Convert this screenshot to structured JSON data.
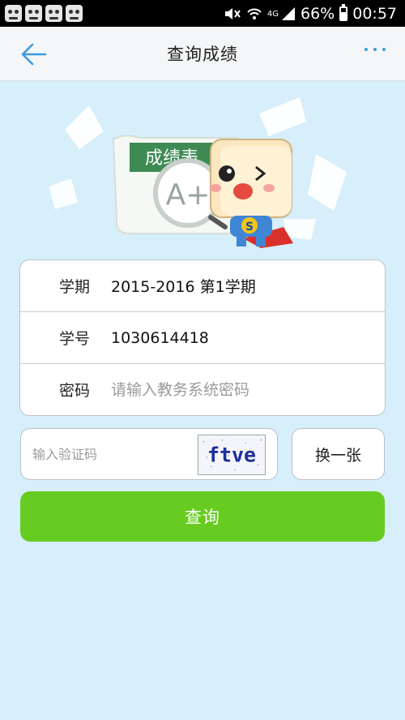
{
  "status_bar": {
    "signal_label": "4G",
    "battery_percent": "66%",
    "time": "00:57",
    "icons": [
      "app-notification-icon",
      "app-notification-icon",
      "app-notification-icon",
      "app-notification-icon",
      "mute-icon",
      "wifi-icon",
      "signal-icon",
      "battery-icon"
    ]
  },
  "header": {
    "title": "查询成绩",
    "back_icon": "back-arrow-icon",
    "more_icon": "more-icon"
  },
  "banner": {
    "sheet_label": "成绩表",
    "grade_text": "A+",
    "mascot_badge": "S"
  },
  "form": {
    "semester": {
      "label": "学期",
      "value": "2015-2016 第1学期"
    },
    "student_id": {
      "label": "学号",
      "value": "1030614418"
    },
    "password": {
      "label": "密码",
      "placeholder": "请输入教务系统密码"
    }
  },
  "captcha": {
    "placeholder": "输入验证码",
    "code_text": "ftve",
    "refresh_label": "换一张"
  },
  "submit": {
    "label": "查询"
  },
  "colors": {
    "accent_blue": "#3a9be0",
    "submit_green": "#67cc22",
    "page_bg": "#d7eefb"
  }
}
